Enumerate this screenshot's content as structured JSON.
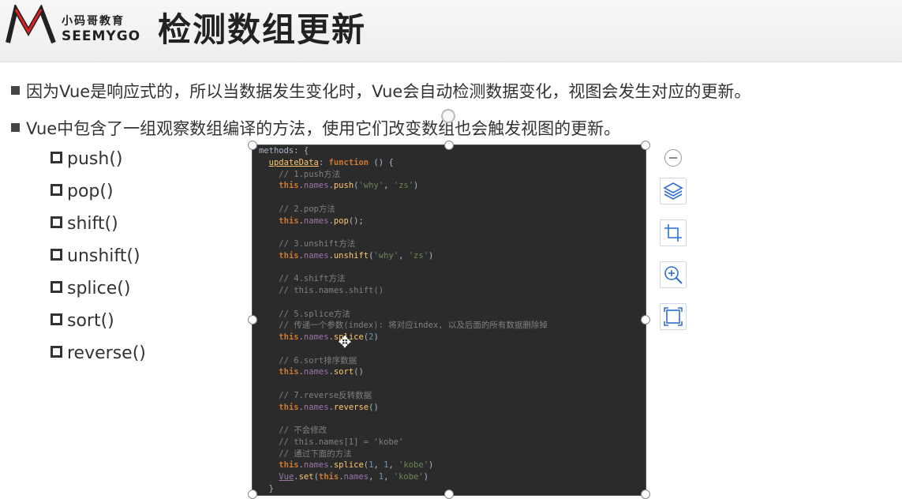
{
  "logo": {
    "cn": "小码哥教育",
    "en": "SEEMYGO"
  },
  "title": "检测数组更新",
  "bullets": [
    "因为Vue是响应式的，所以当数据发生变化时，Vue会自动检测数据变化，视图会发生对应的更新。",
    "Vue中包含了一组观察数组编译的方法，使用它们改变数组也会触发视图的更新。"
  ],
  "methods": [
    "push()",
    "pop()",
    "shift()",
    "unshift()",
    "splice()",
    "sort()",
    "reverse()"
  ],
  "code_lines": [
    "methods: {",
    "  updateData: function () {",
    "    // 1.push方法",
    "    this.names.push('why', 'zs')",
    "",
    "    // 2.pop方法",
    "    this.names.pop();",
    "",
    "    // 3.unshift方法",
    "    this.names.unshift('why', 'zs')",
    "",
    "    // 4.shift方法",
    "    // this.names.shift()",
    "",
    "    // 5.splice方法",
    "    // 传递一个参数(index): 将对应index, 以及后面的所有数据删除掉",
    "    this.names.splice(2)",
    "",
    "    // 6.sort排序数据",
    "    this.names.sort()",
    "",
    "    // 7.reverse反转数据",
    "    this.names.reverse()",
    "",
    "    // 不会修改",
    "    // this.names[1] = 'kobe'",
    "    // 通过下面的方法",
    "    this.names.splice(1, 1, 'kobe')",
    "    Vue.set(this.names, 1, 'kobe')",
    "  }"
  ],
  "toolbar": {
    "icons": [
      "zoom-out-icon",
      "layers-icon",
      "crop-icon",
      "zoom-in-icon",
      "fit-icon"
    ]
  },
  "colors": {
    "code_bg": "#2b2b2b",
    "keyword": "#cc7832",
    "property": "#9876aa",
    "string": "#6a8759",
    "number": "#6897bb",
    "comment": "#808080",
    "accent": "#2f6fd1"
  }
}
